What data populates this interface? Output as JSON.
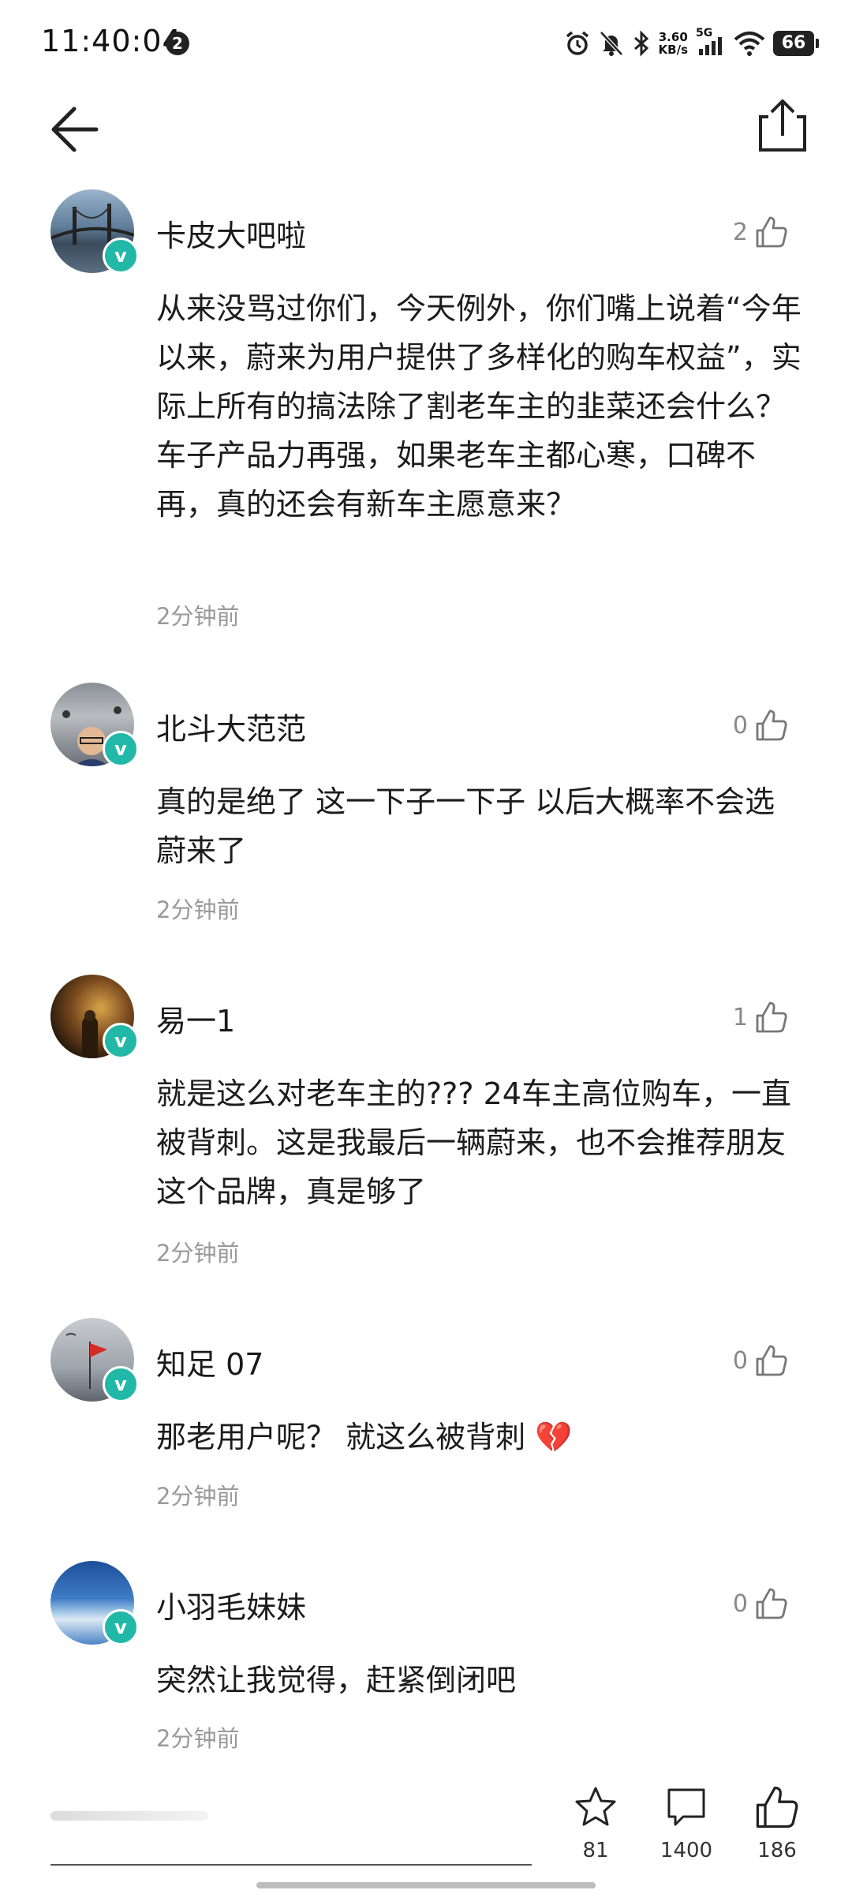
{
  "status": {
    "time": "11:40:04",
    "notification_count": "2",
    "speed_value": "3.60",
    "speed_unit": "KB/s",
    "network": "5G",
    "battery": "66"
  },
  "comments": [
    {
      "user": "卡皮大吧啦",
      "likes": "2",
      "text": "从来没骂过你们，今天例外，你们嘴上说着“今年以来，蔚来为用户提供了多样化的购车权益”，实际上所有的搞法除了割老车主的韭菜还会什么？车子产品力再强，如果老车主都心寒，口碑不再，真的还会有新车主愿意来？",
      "time": "2分钟前"
    },
    {
      "user": "北斗大范范",
      "likes": "0",
      "text": "真的是绝了 这一下子一下子 以后大概率不会选蔚来了",
      "time": "2分钟前"
    },
    {
      "user": "易一1",
      "likes": "1",
      "text": "就是这么对老车主的??? 24车主高位购车，一直被背刺。这是我最后一辆蔚来，也不会推荐朋友这个品牌，真是够了",
      "time": "2分钟前"
    },
    {
      "user": "知足 07",
      "likes": "0",
      "text": "那老用户呢？ 就这么被背刺 💔",
      "time": "2分钟前"
    },
    {
      "user": "小羽毛妹妹",
      "likes": "0",
      "text": "突然让我觉得，赶紧倒闭吧",
      "time": "2分钟前"
    }
  ],
  "bottom": {
    "favorites": "81",
    "comments": "1400",
    "likes": "186"
  },
  "verified_mark": "v",
  "icons": [
    "back-arrow-icon",
    "share-icon",
    "thumb-up-icon",
    "star-icon",
    "comment-icon",
    "alarm-icon",
    "mute-icon",
    "bluetooth-icon",
    "signal-icon",
    "wifi-icon",
    "battery-icon"
  ]
}
